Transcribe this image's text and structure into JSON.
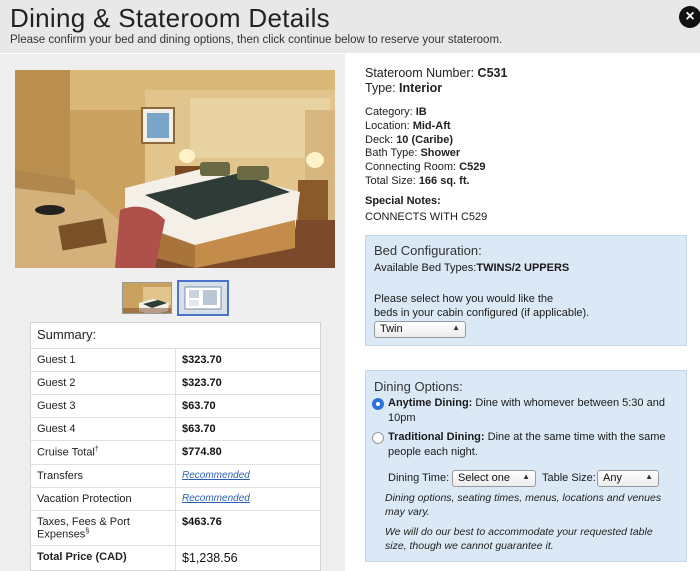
{
  "header": {
    "title": "Dining & Stateroom Details",
    "subtitle": "Please confirm your bed and dining options, then click continue below to reserve your stateroom."
  },
  "close_icon": "×",
  "stateroom": {
    "number_label": "Stateroom Number: ",
    "number": "C531",
    "type_label": "Type: ",
    "type": "Interior",
    "category_label": "Category: ",
    "category": "IB",
    "location_label": "Location: ",
    "location": "Mid-Aft",
    "deck_label": "Deck: ",
    "deck": "10 (Caribe)",
    "bath_label": "Bath Type: ",
    "bath": "Shower",
    "connecting_label": "Connecting Room: ",
    "connecting": "C529",
    "size_label": "Total Size: ",
    "size": "166 sq. ft.",
    "notes_label": "Special Notes:",
    "notes": "CONNECTS WITH C529"
  },
  "bed": {
    "title": "Bed Configuration:",
    "types_label": "Available Bed Types:",
    "types": "TWINS/2 UPPERS",
    "ask_line1": "Please select how you would like the",
    "ask_line2": "beds in your cabin configured (if applicable).",
    "selected": "Twin"
  },
  "dining": {
    "title": "Dining Options:",
    "anytime_label": "Anytime Dining:",
    "anytime_desc1": " Dine with whomever between 5:30 and",
    "anytime_desc2": "10pm",
    "traditional_label": "Traditional Dining:",
    "traditional_desc1": " Dine at the same time with the same",
    "traditional_desc2": "people each night.",
    "time_label": "Dining Time:",
    "time_value": "Select one",
    "table_label": "Table Size:",
    "table_value": "Any",
    "note1_line1": "Dining options, seating times, menus, locations and venues",
    "note1_line2": "may vary.",
    "note2_line1": "We will do our best to accommodate your requested table",
    "note2_line2": "size, though we cannot guarantee it."
  },
  "summary": {
    "title": "Summary:",
    "rows": [
      {
        "label": "Guest 1",
        "value": "$323.70"
      },
      {
        "label": "Guest 2",
        "value": "$323.70"
      },
      {
        "label": "Guest 3",
        "value": "$63.70"
      },
      {
        "label": "Guest 4",
        "value": "$63.70"
      },
      {
        "label": "Cruise Total",
        "sup": "†",
        "value": "$774.80"
      },
      {
        "label": "Transfers",
        "value": "Recommended"
      },
      {
        "label": "Vacation Protection",
        "value": "Recommended"
      },
      {
        "label": "Taxes, Fees & Port Expenses",
        "sup": "§",
        "value": "$463.76"
      },
      {
        "label": "Total Price (CAD)",
        "value": "$1,238.56"
      }
    ]
  }
}
